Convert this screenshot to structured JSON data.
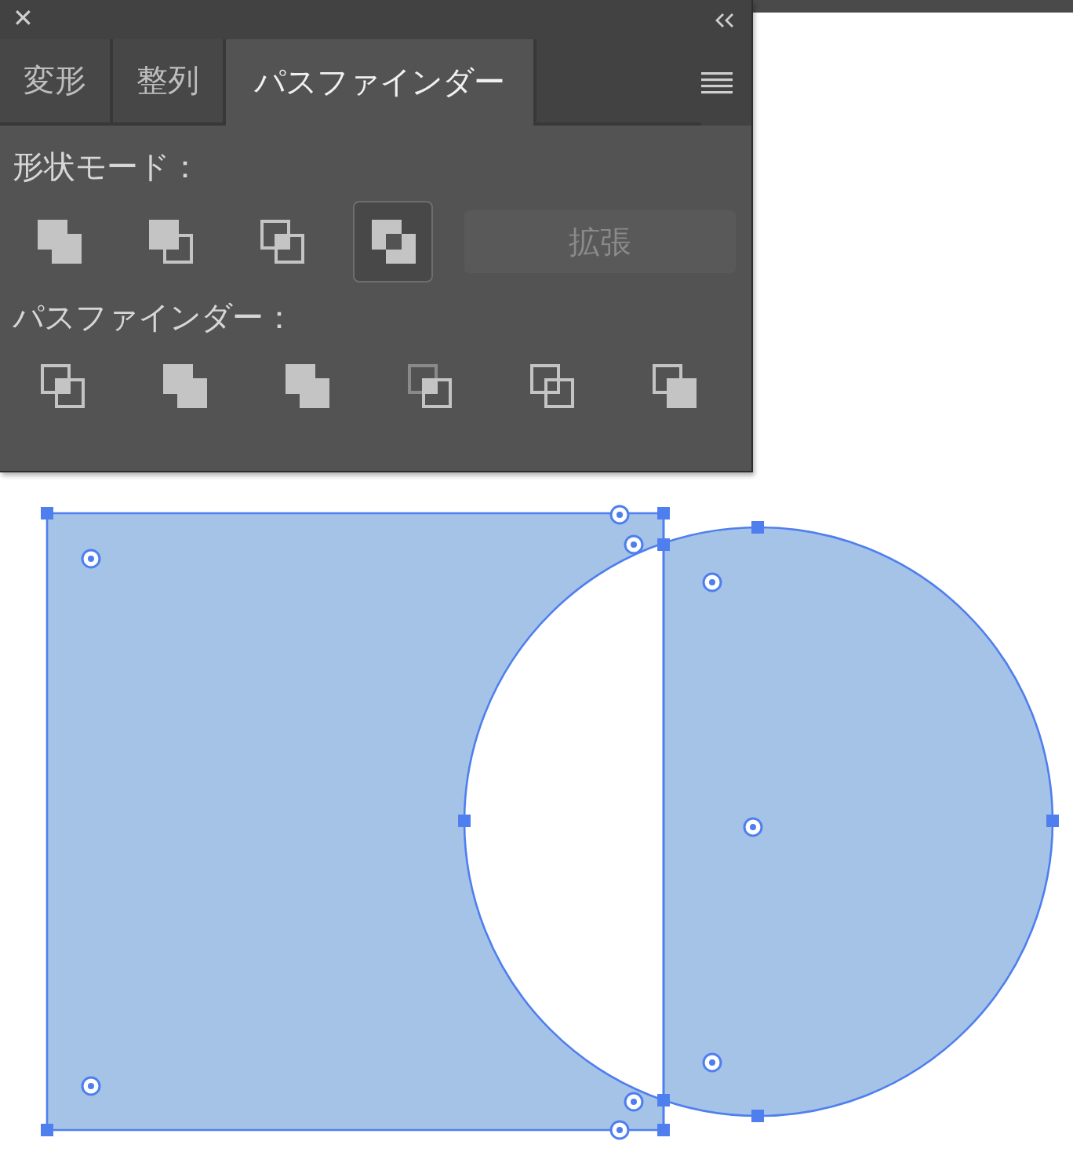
{
  "panel": {
    "close": "✕",
    "tabs": [
      {
        "label": "変形",
        "selected": false
      },
      {
        "label": "整列",
        "selected": false
      },
      {
        "label": "パスファインダー",
        "selected": true
      }
    ],
    "shape_modes": {
      "label": "形状モード：",
      "buttons": [
        {
          "selected": false
        },
        {
          "selected": false
        },
        {
          "selected": false
        },
        {
          "selected": true
        }
      ],
      "expand_button": {
        "label": "拡張",
        "disabled": true
      }
    },
    "pathfinders": {
      "label": "パスファインダー：",
      "buttons": [
        {
          "selected": false
        },
        {
          "selected": false
        },
        {
          "selected": false
        },
        {
          "selected": false
        },
        {
          "selected": false
        },
        {
          "selected": false
        }
      ]
    }
  }
}
